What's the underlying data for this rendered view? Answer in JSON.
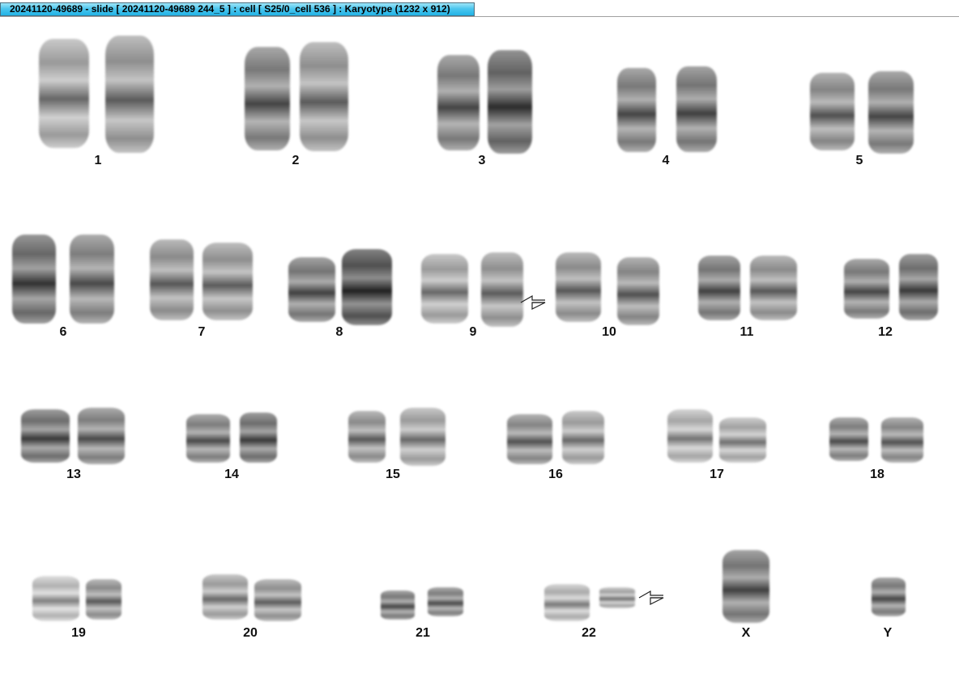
{
  "window": {
    "title": "20241120-49689 - slide [ 20241120-49689 244_5 ] : cell [ S25/0_cell 536 ] : Karyotype  (1232 x 912)"
  },
  "karyotype": {
    "rows": [
      [
        {
          "label": "1"
        },
        {
          "label": "2"
        },
        {
          "label": "3"
        },
        {
          "label": "4"
        },
        {
          "label": "5"
        }
      ],
      [
        {
          "label": "6"
        },
        {
          "label": "7"
        },
        {
          "label": "8"
        },
        {
          "label": "9",
          "marked": true
        },
        {
          "label": "10"
        },
        {
          "label": "11"
        },
        {
          "label": "12"
        }
      ],
      [
        {
          "label": "13"
        },
        {
          "label": "14"
        },
        {
          "label": "15"
        },
        {
          "label": "16"
        },
        {
          "label": "17"
        },
        {
          "label": "18"
        }
      ],
      [
        {
          "label": "19"
        },
        {
          "label": "20"
        },
        {
          "label": "21"
        },
        {
          "label": "22",
          "marked": true
        },
        {
          "label": "X",
          "single": true
        },
        {
          "label": "Y",
          "single": true
        }
      ]
    ],
    "marker_icon": "open-arrow-left-icon"
  }
}
